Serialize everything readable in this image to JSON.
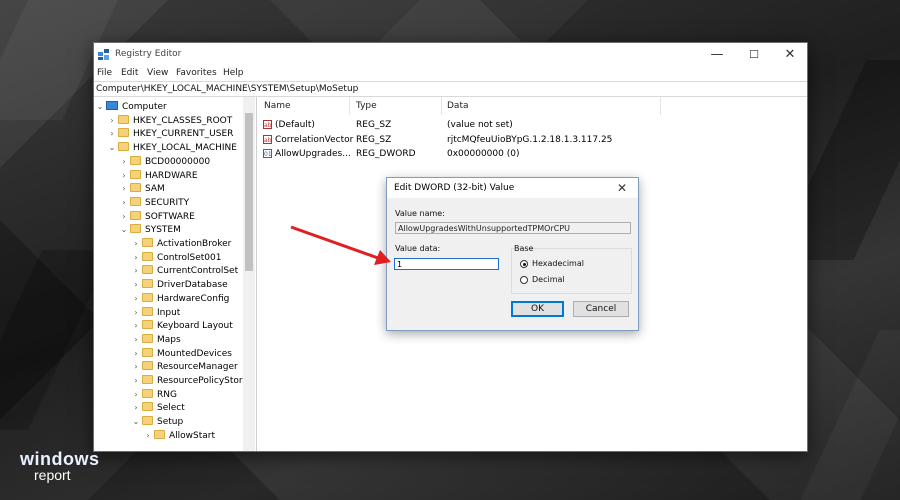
{
  "window": {
    "title": "Registry Editor",
    "minimize_glyph": "—",
    "maximize_glyph": "☐",
    "close_glyph": "✕",
    "app_icon": "registry-editor-icon"
  },
  "menu": [
    "File",
    "Edit",
    "View",
    "Favorites",
    "Help"
  ],
  "address": "Computer\\HKEY_LOCAL_MACHINE\\SYSTEM\\Setup\\MoSetup",
  "tree": [
    {
      "label": "Computer",
      "expanded": true,
      "icon": "computer-icon"
    },
    {
      "label": "HKEY_CLASSES_ROOT",
      "expanded": false
    },
    {
      "label": "HKEY_CURRENT_USER",
      "expanded": false
    },
    {
      "label": "HKEY_LOCAL_MACHINE",
      "expanded": true
    },
    {
      "label": "BCD00000000",
      "expanded": false
    },
    {
      "label": "HARDWARE",
      "expanded": false
    },
    {
      "label": "SAM",
      "expanded": false
    },
    {
      "label": "SECURITY",
      "expanded": false
    },
    {
      "label": "SOFTWARE",
      "expanded": false
    },
    {
      "label": "SYSTEM",
      "expanded": true
    },
    {
      "label": "ActivationBroker",
      "expanded": false
    },
    {
      "label": "ControlSet001",
      "expanded": false
    },
    {
      "label": "CurrentControlSet",
      "expanded": false
    },
    {
      "label": "DriverDatabase",
      "expanded": false
    },
    {
      "label": "HardwareConfig",
      "expanded": false
    },
    {
      "label": "Input",
      "expanded": false
    },
    {
      "label": "Keyboard Layout",
      "expanded": false
    },
    {
      "label": "Maps",
      "expanded": false
    },
    {
      "label": "MountedDevices",
      "expanded": false
    },
    {
      "label": "ResourceManager",
      "expanded": false
    },
    {
      "label": "ResourcePolicyStore",
      "expanded": false
    },
    {
      "label": "RNG",
      "expanded": false
    },
    {
      "label": "Select",
      "expanded": false
    },
    {
      "label": "Setup",
      "expanded": true
    },
    {
      "label": "AllowStart",
      "expanded": false
    }
  ],
  "columns": [
    "Name",
    "Type",
    "Data"
  ],
  "values": [
    {
      "name": "(Default)",
      "type": "REG_SZ",
      "data": "(value not set)",
      "icon": "ab"
    },
    {
      "name": "CorrelationVector",
      "type": "REG_SZ",
      "data": "rjtcMQfeuUioBYpG.1.2.18.1.3.117.25",
      "icon": "ab"
    },
    {
      "name": "AllowUpgrades...",
      "type": "REG_DWORD",
      "data": "0x00000000 (0)",
      "icon": "bin"
    }
  ],
  "dialog": {
    "title": "Edit DWORD (32-bit) Value",
    "close_glyph": "✕",
    "value_name_label": "Value name:",
    "value_name": "AllowUpgradesWithUnsupportedTPMOrCPU",
    "value_data_label": "Value data:",
    "value_data": "1",
    "base_label": "Base",
    "base_options": [
      "Hexadecimal",
      "Decimal"
    ],
    "base_selected": "Hexadecimal",
    "ok_label": "OK",
    "cancel_label": "Cancel"
  },
  "annotation_arrow_color": "#e02020",
  "brand": {
    "line1": "windows",
    "line2": "report"
  }
}
